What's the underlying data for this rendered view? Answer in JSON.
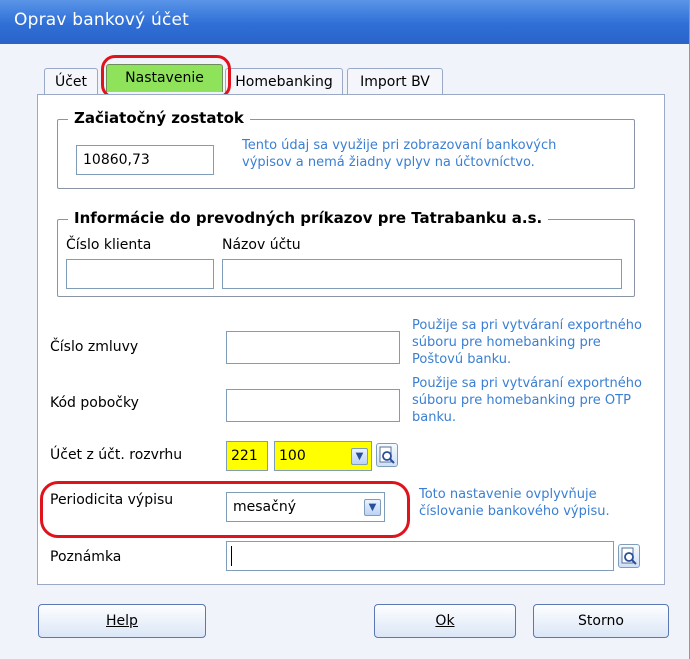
{
  "window": {
    "title": "Oprav bankový účet"
  },
  "tabs": [
    {
      "label": "Účet"
    },
    {
      "label": "Nastavenie"
    },
    {
      "label": "Homebanking"
    },
    {
      "label": "Import BV"
    }
  ],
  "opening_balance": {
    "legend": "Začiatočný zostatok",
    "value": "10860,73",
    "hint_line1": "Tento údaj sa využije pri zobrazovaní bankových",
    "hint_line2": "výpisov a nemá žiadny vplyv na účtovníctvo."
  },
  "transfer_info": {
    "legend": "Informácie do prevodných príkazov pre Tatrabanku a.s.",
    "client_number_label": "Číslo klienta",
    "account_name_label": "Názov účtu",
    "client_number_value": "",
    "account_name_value": ""
  },
  "contract": {
    "label": "Číslo zmluvy",
    "value": "",
    "hint_line1": "Použije sa pri vytváraní exportného",
    "hint_line2": "súboru pre homebanking pre",
    "hint_line3": "Poštovú banku."
  },
  "branch": {
    "label": "Kód pobočky",
    "value": "",
    "hint_line1": "Použije sa pri vytváraní exportného",
    "hint_line2": "súboru pre homebanking pre OTP",
    "hint_line3": "banku."
  },
  "account_chart": {
    "label": "Účet z účt. rozvrhu",
    "synthetic": "221",
    "analytic": "100",
    "highlight_color": "#ffff00"
  },
  "periodicity": {
    "label": "Periodicita výpisu",
    "selected": "mesačný",
    "hint_line1": "Toto nastavenie ovplyvňuje",
    "hint_line2": "číslovanie bankového výpisu."
  },
  "note": {
    "label": "Poznámka",
    "value": ""
  },
  "buttons": {
    "help": "Help",
    "ok": "Ok",
    "cancel": "Storno"
  },
  "colors": {
    "title_bar": "#2f6fd6",
    "active_tab": "#8ee35a",
    "highlight_ring": "#e0131d",
    "hint_text": "#3a7fd3"
  }
}
